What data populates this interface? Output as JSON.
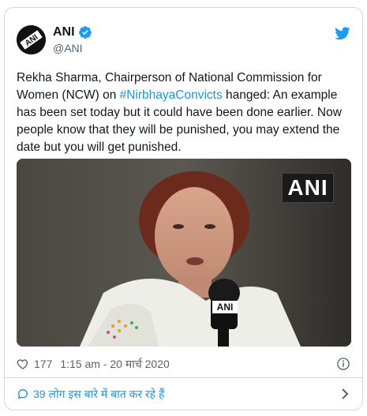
{
  "tweet": {
    "author": {
      "display_name": "ANI",
      "handle": "@ANI",
      "avatar_icon": "ani-logo-avatar",
      "verified": true
    },
    "text_before_hashtag": "Rekha Sharma, Chairperson of National Commission for Women (NCW) on ",
    "hashtag": "#NirbhayaConvicts",
    "text_after_hashtag": " hanged: An example has been set today but it could have been done earlier. Now people know that they will be punished, you may extend the date but you will get punished.",
    "media": {
      "watermark": "ANI",
      "mic_label": "ANI"
    },
    "likes": "177",
    "timestamp": "1:15 am - 20 मार्च 2020",
    "footer_text": "39 लोग इस बारे में बात कर रहे हैं"
  },
  "colors": {
    "link": "#1b95e0",
    "verified": "#1d9bf0",
    "text": "#14171a",
    "muted": "#536471",
    "border": "#cfd9de"
  },
  "icons": [
    "twitter-bird-icon",
    "verified-badge-icon",
    "heart-icon",
    "info-icon",
    "reply-bubble-icon",
    "chevron-right-icon"
  ]
}
